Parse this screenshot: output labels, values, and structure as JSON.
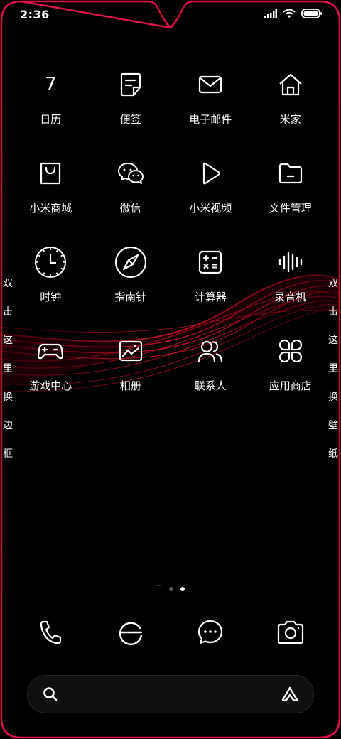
{
  "status_bar": {
    "time": "2:36",
    "icons": [
      "signal-icon",
      "wifi-icon",
      "battery-icon"
    ]
  },
  "apps": [
    {
      "label": "日历",
      "icon": "calendar-icon",
      "text": "7"
    },
    {
      "label": "便签",
      "icon": "notes-icon"
    },
    {
      "label": "电子邮件",
      "icon": "mail-icon"
    },
    {
      "label": "米家",
      "icon": "home-icon"
    },
    {
      "label": "小米商城",
      "icon": "shopping-bag-icon"
    },
    {
      "label": "微信",
      "icon": "wechat-icon"
    },
    {
      "label": "小米视频",
      "icon": "play-icon"
    },
    {
      "label": "文件管理",
      "icon": "folder-icon"
    },
    {
      "label": "时钟",
      "icon": "clock-icon"
    },
    {
      "label": "指南针",
      "icon": "compass-icon"
    },
    {
      "label": "计算器",
      "icon": "calculator-icon"
    },
    {
      "label": "录音机",
      "icon": "recorder-icon"
    },
    {
      "label": "游戏中心",
      "icon": "gamepad-icon"
    },
    {
      "label": "相册",
      "icon": "gallery-icon"
    },
    {
      "label": "联系人",
      "icon": "contacts-icon"
    },
    {
      "label": "应用商店",
      "icon": "app-store-icon"
    }
  ],
  "side_left": [
    "双",
    "击",
    "这",
    "里",
    "换",
    "边",
    "框"
  ],
  "side_right": [
    "双",
    "击",
    "这",
    "里",
    "换",
    "壁",
    "纸"
  ],
  "page_indicator": {
    "total_dots": 2,
    "active_index": 1
  },
  "dock": [
    {
      "icon": "phone-icon"
    },
    {
      "icon": "browser-icon"
    },
    {
      "icon": "message-icon"
    },
    {
      "icon": "camera-icon"
    }
  ],
  "search": {
    "left_icon": "search-icon",
    "right_icon": "assistant-icon"
  },
  "colors": {
    "border": "#e0104a",
    "accent": "#c8102e",
    "background": "#000000"
  }
}
